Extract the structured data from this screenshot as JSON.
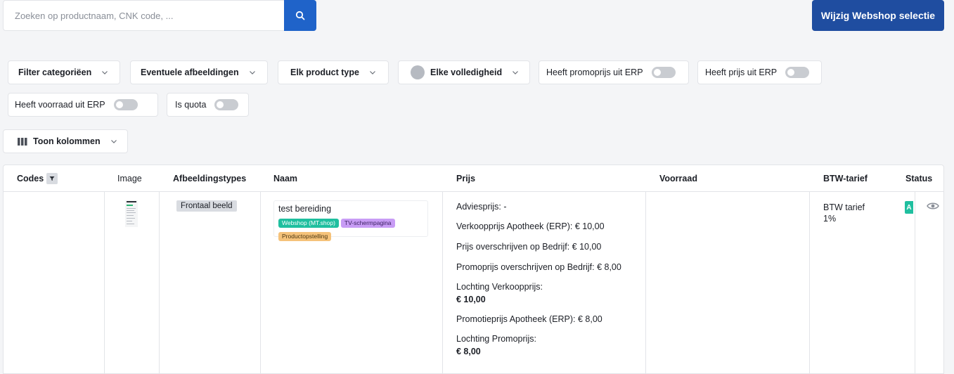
{
  "search": {
    "placeholder": "Zoeken op productnaam, CNK code, ..."
  },
  "header": {
    "change_webshop_label": "Wijzig Webshop selectie"
  },
  "filters": {
    "categories": "Filter categoriëen",
    "images": "Eventuele afbeeldingen",
    "product_type": "Elk product type",
    "completeness": "Elke volledigheid",
    "promo_erp": "Heeft promoprijs uit ERP",
    "price_erp": "Heeft prijs uit ERP",
    "stock_erp": "Heeft voorraad uit ERP",
    "quota": "Is quota",
    "columns": "Toon kolommen"
  },
  "table": {
    "columns": [
      "Codes",
      "Image",
      "Afbeeldingstypes",
      "Naam",
      "Prijs",
      "Voorraad",
      "BTW-tarief",
      "Status"
    ],
    "row": {
      "image_type": "Frontaal beeld",
      "name": "test bereiding",
      "tags": [
        "Webshop (MT.shop)",
        "TV-schermpagina",
        "Productopstelling"
      ],
      "prices": {
        "advice": "Adviesprijs: -",
        "sell_erp": "Verkoopprijs Apotheek (ERP): € 10,00",
        "override_price": "Prijs overschrijven op Bedrijf:  € 10,00",
        "override_promo": "Promoprijs overschrijven op Bedrijf:  € 8,00",
        "lochting_sell_label": "Lochting Verkoopprijs:",
        "lochting_sell_value": "€ 10,00",
        "promo_erp": "Promotieprijs Apotheek (ERP): € 8,00",
        "lochting_promo_label": "Lochting Promoprijs:",
        "lochting_promo_value": "€ 8,00"
      },
      "vat_line1": "BTW tarief",
      "vat_line2": "1%",
      "status_badge": "A"
    }
  },
  "colors": {
    "primary": "#1f4da0",
    "search_button": "#1f63c9",
    "tag_green": "#1fbf9f",
    "tag_purple": "#c89cf5",
    "tag_orange": "#f5c27a"
  },
  "icons": [
    "search-icon",
    "chevron-down-icon",
    "columns-icon",
    "filter-icon",
    "eye-icon"
  ]
}
